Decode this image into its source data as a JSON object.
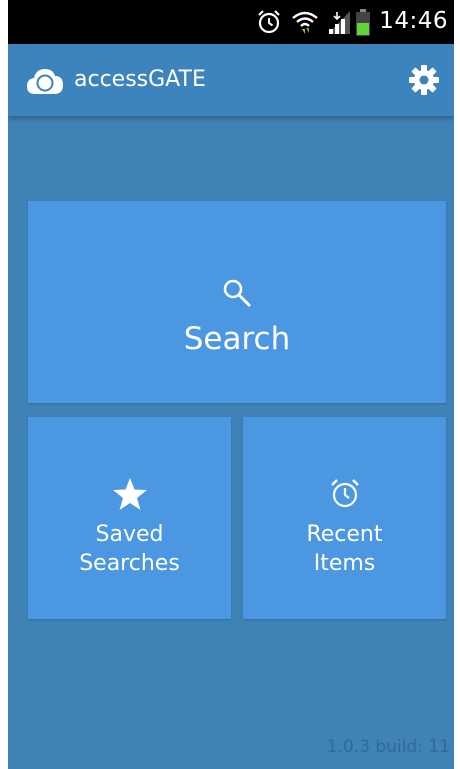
{
  "status_bar": {
    "time": "14:46",
    "icons": [
      "alarm-icon",
      "wifi-icon",
      "signal-icon",
      "battery-icon"
    ]
  },
  "app_bar": {
    "title": "accessGATE",
    "logo_icon": "cloud-compass-icon",
    "settings_icon": "gear-icon"
  },
  "tiles": {
    "search": {
      "label": "Search",
      "icon": "search-icon"
    },
    "saved": {
      "line1": "Saved",
      "line2": "Searches",
      "icon": "star-icon"
    },
    "recent": {
      "line1": "Recent",
      "line2": "Items",
      "icon": "alarm-clock-icon"
    }
  },
  "footer": {
    "version": "1.0.3 build: 11"
  },
  "colors": {
    "background": "#3e82b6",
    "app_bar": "#3d83bd",
    "tile": "#4c97e2",
    "version_text": "#2f6a9b"
  }
}
